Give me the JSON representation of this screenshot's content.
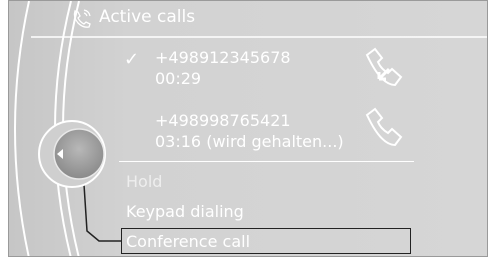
{
  "header": {
    "title": "Active calls",
    "icon": "phone-call-icon"
  },
  "calls": [
    {
      "number": "+498912345678",
      "time": "00:29",
      "active": true,
      "check": "✓",
      "icon": "phone-handset-incoming-icon"
    },
    {
      "number": "+498998765421",
      "time": "03:16 (wird gehalten...)",
      "active": false,
      "icon": "phone-handset-icon"
    }
  ],
  "menu": {
    "hold": "Hold",
    "keypad": "Keypad dialing",
    "conference": "Conference call"
  },
  "controller": {
    "icon": "back-arrow-icon"
  }
}
